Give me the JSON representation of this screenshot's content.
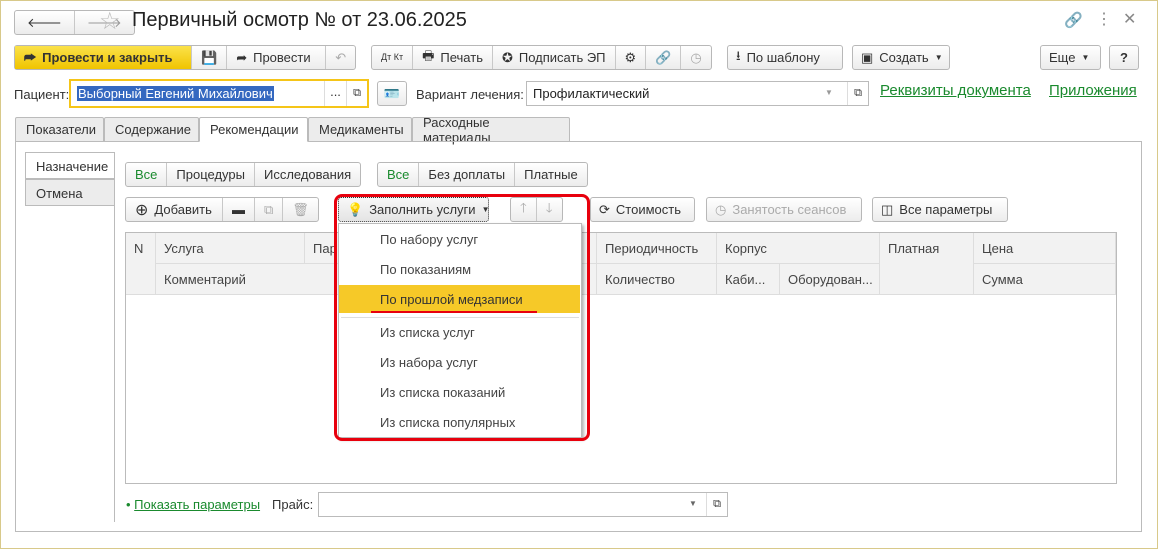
{
  "title": "Первичный осмотр №  от 23.06.2025",
  "toolbar": {
    "post_close": "Провести и закрыть",
    "post": "Провести",
    "print": "Печать",
    "sign": "Подписать ЭП",
    "by_template": "По шаблону",
    "create": "Создать",
    "more": "Еще",
    "help": "?",
    "dtkt": "Дт Кт"
  },
  "patient": {
    "label": "Пациент:",
    "value": "Выборный Евгений Михайлович",
    "dots": "..."
  },
  "treatment": {
    "label": "Вариант лечения:",
    "value": "Профилактический"
  },
  "links": {
    "details": "Реквизиты документа",
    "attachments": "Приложения"
  },
  "tabs": [
    "Показатели",
    "Содержание",
    "Рекомендации",
    "Медикаменты",
    "Расходные материалы"
  ],
  "side_tabs": [
    "Назначение",
    "Отмена"
  ],
  "filter1": [
    "Все",
    "Процедуры",
    "Исследования"
  ],
  "filter2": [
    "Все",
    "Без доплаты",
    "Платные"
  ],
  "table_toolbar": {
    "add": "Добавить",
    "fill": "Заполнить услуги",
    "cost": "Стоимость",
    "sessions": "Занятость сеансов",
    "all_params": "Все параметры"
  },
  "columns": {
    "n": "N",
    "service": "Услуга",
    "param": "Пар",
    "comment": "Комментарий",
    "period": "Периодичность",
    "building": "Корпус",
    "paid": "Платная",
    "price": "Цена",
    "qty": "Количество",
    "cabinet": "Каби...",
    "equipment": "Оборудован...",
    "sum": "Сумма"
  },
  "menu": [
    "По набору услуг",
    "По показаниям",
    "По прошлой медзаписи",
    "Из списка услуг",
    "Из набора услуг",
    "Из списка показаний",
    "Из списка популярных"
  ],
  "footer": {
    "show_params": "Показать параметры",
    "price_label": "Прайс:",
    "price_value": ""
  },
  "colors": {
    "accent": "#f5cc1f",
    "highlight": "#f6c928",
    "link": "#1a8a2e",
    "annotation": "#e8000d"
  }
}
